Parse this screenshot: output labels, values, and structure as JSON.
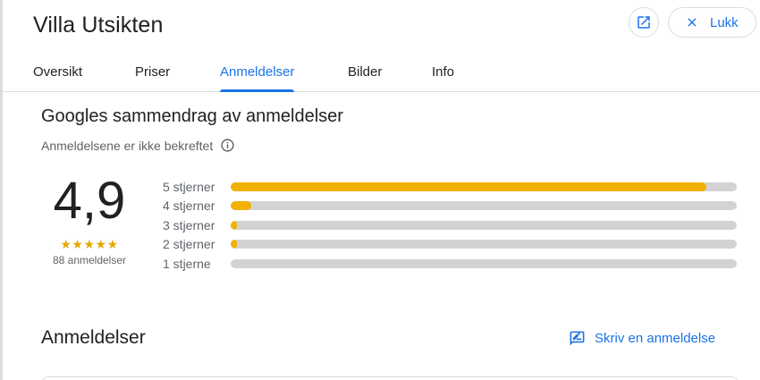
{
  "window": {
    "title": "Villa Utsikten",
    "close_label": "Lukk",
    "open_icon": "open-in-new-icon",
    "close_icon": "close-icon"
  },
  "tabs": [
    {
      "label": "Oversikt",
      "active": false
    },
    {
      "label": "Priser",
      "active": false
    },
    {
      "label": "Anmeldelser",
      "active": true
    },
    {
      "label": "Bilder",
      "active": false
    },
    {
      "label": "Info",
      "active": false
    }
  ],
  "summary": {
    "title": "Googles sammendrag av anmeldelser",
    "subtitle": "Anmeldelsene er ikke bekreftet",
    "info_icon": "info-icon",
    "rating": "4,9",
    "stars": "★★★★★",
    "count": "88 anmeldelser",
    "accent_color": "#f2b100",
    "distribution": [
      {
        "label": "5 stjerner",
        "fraction": 0.94
      },
      {
        "label": "4 stjerner",
        "fraction": 0.04
      },
      {
        "label": "3 stjerner",
        "fraction": 0.01
      },
      {
        "label": "2 stjerner",
        "fraction": 0.01
      },
      {
        "label": "1 stjerne",
        "fraction": 0.0
      }
    ]
  },
  "reviews": {
    "title": "Anmeldelser",
    "write_label": "Skriv en anmeldelse",
    "write_icon": "rate-review-icon"
  },
  "colors": {
    "link": "#1a73e8",
    "text": "#202124",
    "muted": "#5f6368",
    "bar_track": "#d3d3d3"
  }
}
